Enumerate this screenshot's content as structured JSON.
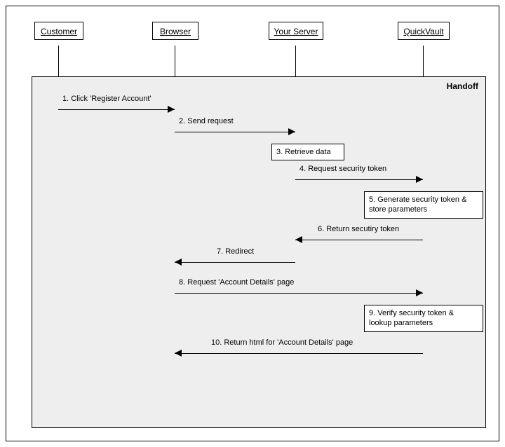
{
  "participants": {
    "customer": "Customer",
    "browser": "Browser",
    "server": "Your Server",
    "quickvault": "QuickVault"
  },
  "handoff_label": "Handoff",
  "messages": {
    "m1": "1. Click 'Register Account'",
    "m2": "2. Send request",
    "m4": "4. Request security token",
    "m6": "6. Return secutiry token",
    "m7": "7. Redirect",
    "m8": "8. Request 'Account Details' page",
    "m10": "10. Return html for 'Account Details' page"
  },
  "nodes": {
    "n3": "3. Retrieve data",
    "n5": "5. Generate security token & store parameters",
    "n9": "9. Verify security token & lookup parameters"
  },
  "chart_data": {
    "type": "sequence-diagram",
    "participants": [
      "Customer",
      "Browser",
      "Your Server",
      "QuickVault"
    ],
    "fragment": {
      "name": "Handoff",
      "covers_steps": [
        1,
        2,
        3,
        4,
        5,
        6,
        7,
        8,
        9,
        10
      ]
    },
    "steps": [
      {
        "n": 1,
        "from": "Customer",
        "to": "Browser",
        "label": "Click 'Register Account'"
      },
      {
        "n": 2,
        "from": "Browser",
        "to": "Your Server",
        "label": "Send request"
      },
      {
        "n": 3,
        "at": "Your Server",
        "label": "Retrieve data",
        "self": true
      },
      {
        "n": 4,
        "from": "Your Server",
        "to": "QuickVault",
        "label": "Request security token"
      },
      {
        "n": 5,
        "at": "QuickVault",
        "label": "Generate security token & store parameters",
        "self": true
      },
      {
        "n": 6,
        "from": "QuickVault",
        "to": "Your Server",
        "label": "Return secutiry token"
      },
      {
        "n": 7,
        "from": "Your Server",
        "to": "Browser",
        "label": "Redirect"
      },
      {
        "n": 8,
        "from": "Browser",
        "to": "QuickVault",
        "label": "Request 'Account Details' page"
      },
      {
        "n": 9,
        "at": "QuickVault",
        "label": "Verify security token & lookup parameters",
        "self": true
      },
      {
        "n": 10,
        "from": "QuickVault",
        "to": "Browser",
        "label": "Return html for 'Account Details' page"
      }
    ]
  }
}
